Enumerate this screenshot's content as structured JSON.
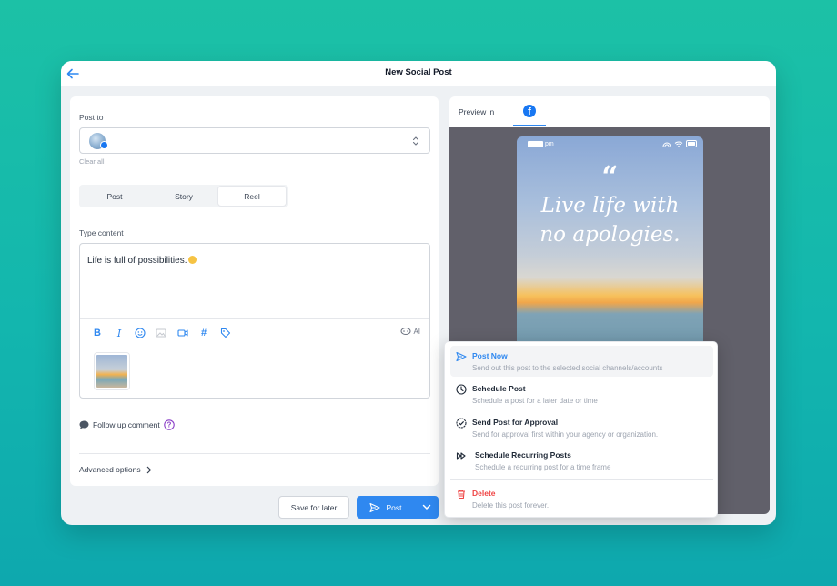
{
  "window": {
    "title": "New Social Post"
  },
  "left": {
    "post_to_label": "Post to",
    "clear_all": "Clear all",
    "tabs": [
      {
        "label": "Post"
      },
      {
        "label": "Story"
      },
      {
        "label": "Reel"
      }
    ],
    "active_tab": "Reel",
    "content_label": "Type content",
    "content_value": "Life is full of possibilities.",
    "ai_label": "AI",
    "follow_up": "Follow up comment",
    "advanced": "Advanced options"
  },
  "actions": {
    "save_label": "Save for later",
    "post_label": "Post"
  },
  "preview": {
    "label": "Preview in",
    "time_suffix": "pm",
    "quote_mark": "“",
    "quote_line1": "Live life with",
    "quote_line2": "no apologies."
  },
  "menu": {
    "items": [
      {
        "title": "Post Now",
        "desc": "Send out this post to the selected social channels/accounts"
      },
      {
        "title": "Schedule Post",
        "desc": "Schedule a post for a later date or time"
      },
      {
        "title": "Send Post for Approval",
        "desc": "Send for approval first within your agency or organization."
      },
      {
        "title": "Schedule Recurring Posts",
        "desc": "Schedule a recurring post for a time frame"
      },
      {
        "title": "Delete",
        "desc": "Delete this post forever."
      }
    ]
  },
  "colors": {
    "accent": "#2f88f0",
    "facebook": "#1877f2",
    "danger": "#ef4444",
    "background_teal": "#13b6ae"
  },
  "icons": [
    "back-arrow-icon",
    "chevron-updown-icon",
    "bold-icon",
    "italic-icon",
    "emoji-icon",
    "image-icon",
    "video-icon",
    "hashtag-icon",
    "tag-icon",
    "ai-icon",
    "comment-icon",
    "help-icon",
    "chevron-right-icon",
    "send-icon",
    "chevron-down-icon",
    "facebook-icon",
    "clock-icon",
    "approval-check-icon",
    "recurring-icon",
    "trash-icon"
  ]
}
